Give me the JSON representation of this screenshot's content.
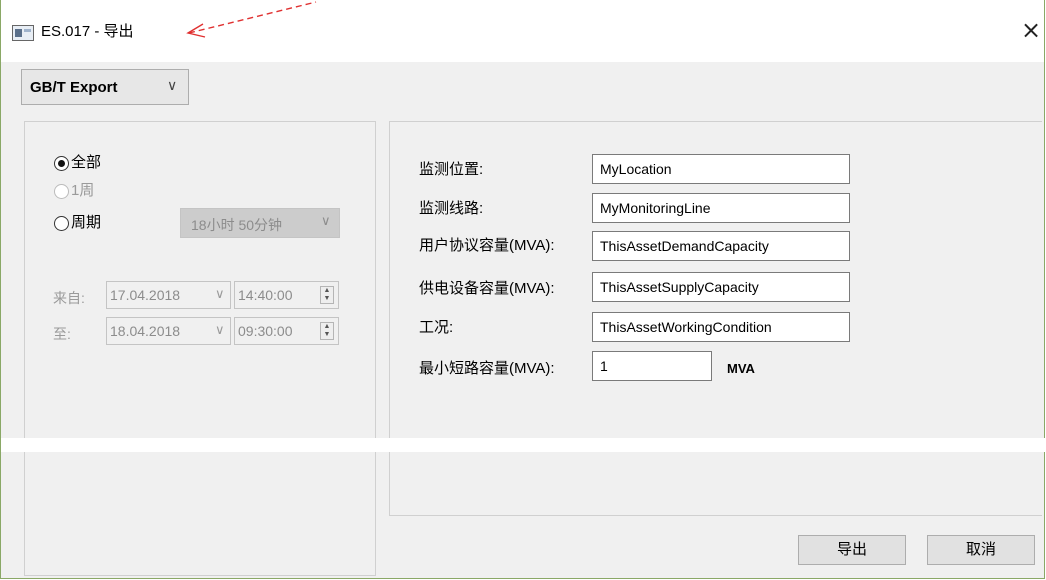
{
  "window": {
    "title": "ES.017 - 导出",
    "close_icon": "close-icon"
  },
  "export_type": {
    "selected": "GB/T Export"
  },
  "range": {
    "options": [
      {
        "label": "全部",
        "selected": true,
        "enabled": true
      },
      {
        "label": "1周",
        "selected": false,
        "enabled": false
      },
      {
        "label": "周期",
        "selected": false,
        "enabled": true
      }
    ],
    "period_value": "18小时 50分钟",
    "from_label": "来自:",
    "from_date": "17.04.2018",
    "from_time": "14:40:00",
    "to_label": "至:",
    "to_date": "18.04.2018",
    "to_time": "09:30:00"
  },
  "fields": [
    {
      "label": "监测位置:",
      "value": "MyLocation"
    },
    {
      "label": "监测线路:",
      "value": "MyMonitoringLine"
    },
    {
      "label": "用户协议容量(MVA):",
      "value": "ThisAssetDemandCapacity"
    },
    {
      "label": "供电设备容量(MVA):",
      "value": "ThisAssetSupplyCapacity"
    },
    {
      "label": "工况:",
      "value": "ThisAssetWorkingCondition"
    },
    {
      "label": "最小短路容量(MVA):",
      "value": "1"
    }
  ],
  "unit": "MVA",
  "buttons": {
    "export": "导出",
    "cancel": "取消"
  }
}
